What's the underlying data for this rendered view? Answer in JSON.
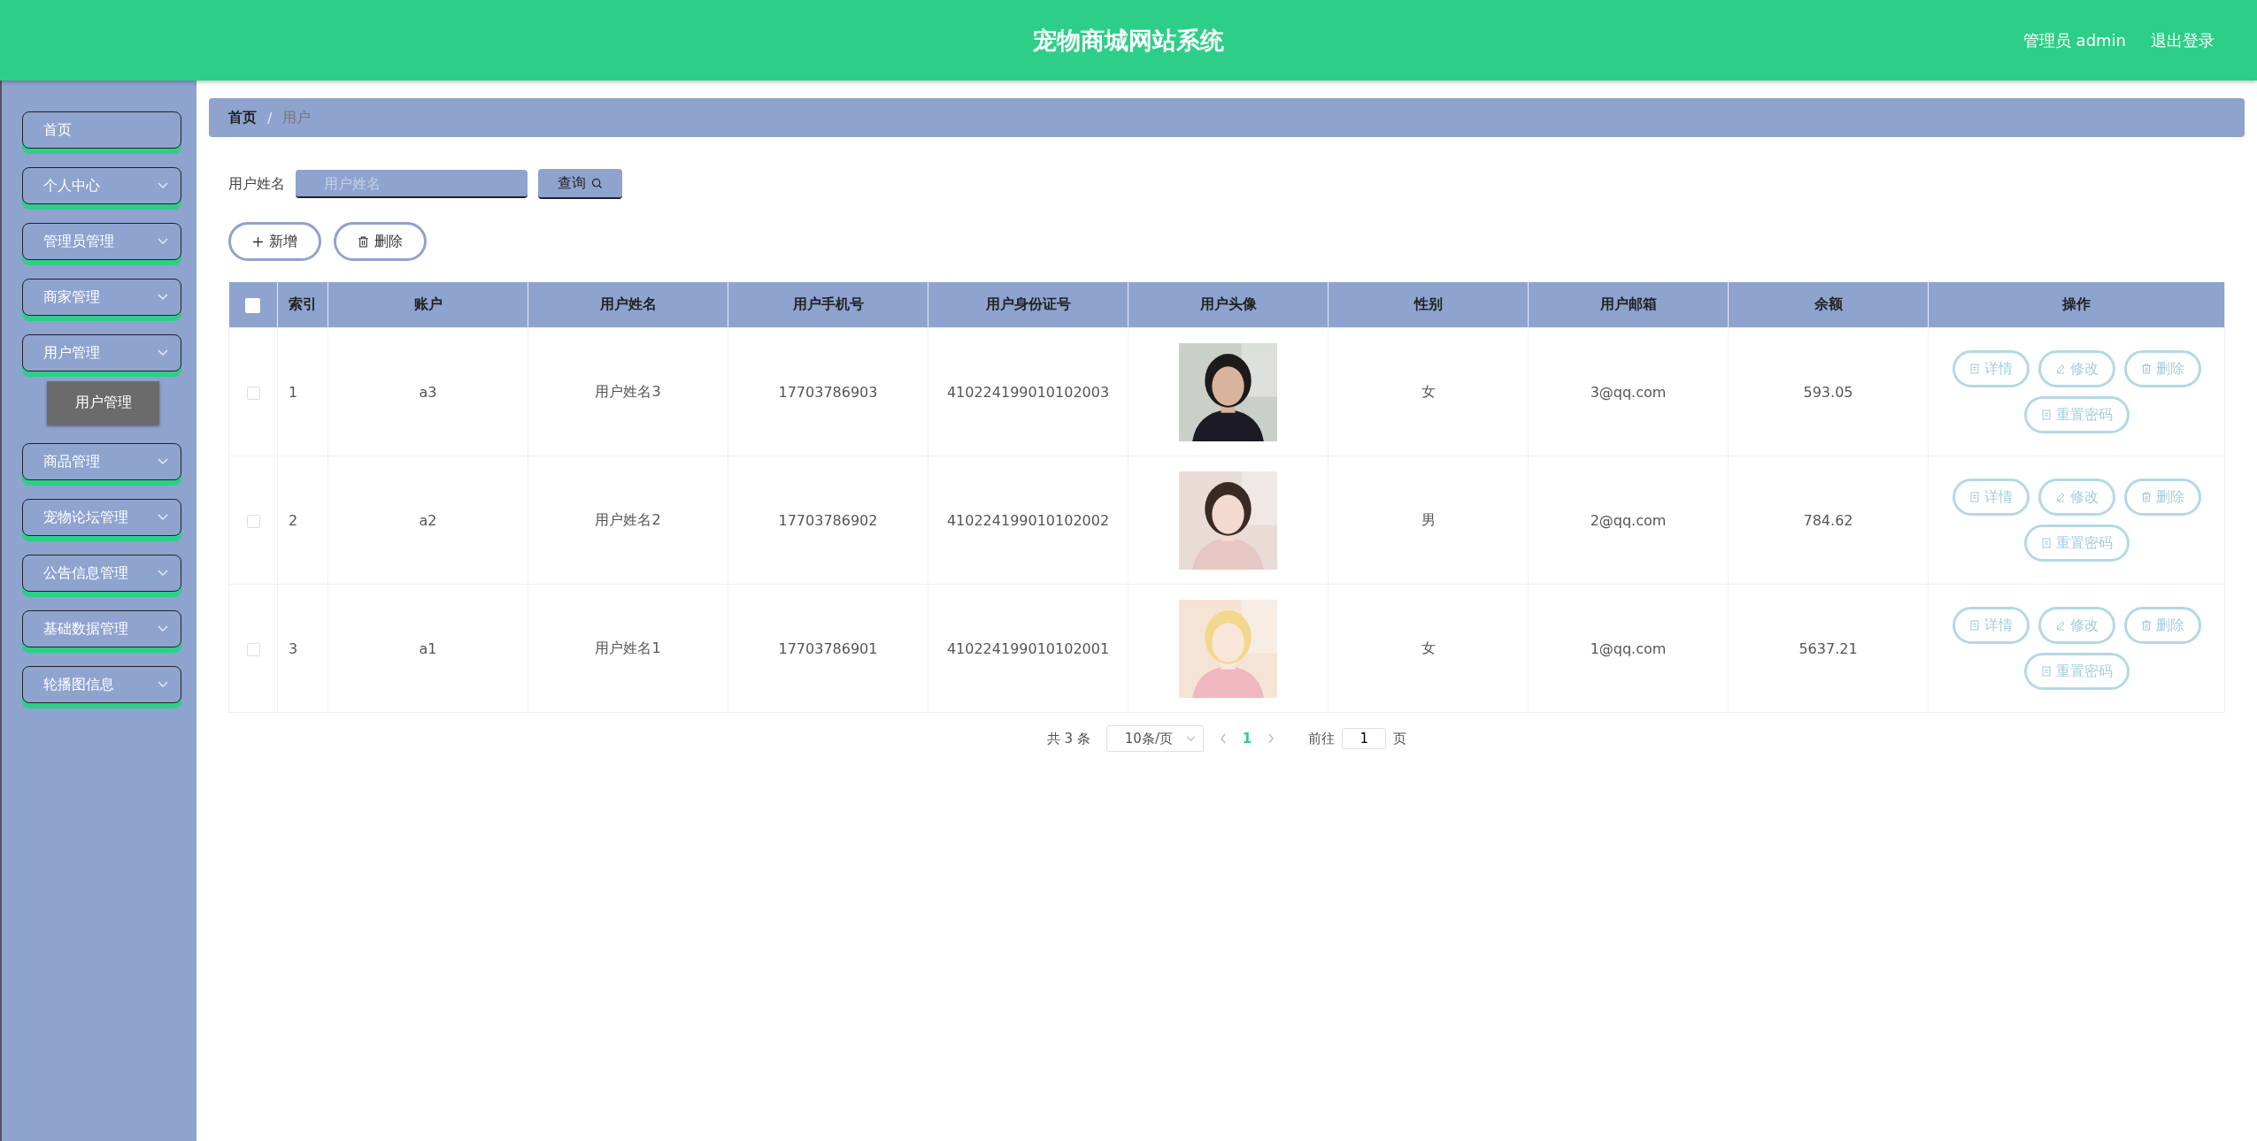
{
  "header": {
    "title": "宠物商城网站系统",
    "user": "管理员 admin",
    "logout": "退出登录"
  },
  "sidebar": {
    "items": [
      {
        "label": "首页",
        "kind": "link"
      },
      {
        "label": "个人中心",
        "kind": "menu"
      },
      {
        "label": "管理员管理",
        "kind": "menu"
      },
      {
        "label": "商家管理",
        "kind": "menu"
      },
      {
        "label": "用户管理",
        "kind": "menu",
        "children": [
          {
            "label": "用户管理",
            "selected": true
          }
        ]
      },
      {
        "label": "商品管理",
        "kind": "menu"
      },
      {
        "label": "宠物论坛管理",
        "kind": "menu"
      },
      {
        "label": "公告信息管理",
        "kind": "menu"
      },
      {
        "label": "基础数据管理",
        "kind": "menu"
      },
      {
        "label": "轮播图信息",
        "kind": "menu"
      }
    ]
  },
  "breadcrumb": {
    "separator": "/",
    "items": [
      "首页",
      "用户"
    ]
  },
  "search": {
    "label": "用户姓名",
    "placeholder": "用户姓名",
    "button": "查询"
  },
  "actions": [
    {
      "label": "新增",
      "kind": "add"
    },
    {
      "label": "删除",
      "kind": "delete"
    }
  ],
  "table": {
    "select_all": {
      "checked": false
    },
    "columns": [
      "索引",
      "账户",
      "用户姓名",
      "用户手机号",
      "用户身份证号",
      "用户头像",
      "性别",
      "用户邮箱",
      "余额",
      "操作"
    ],
    "rows": [
      {
        "checked": false,
        "index": "1",
        "account": "a3",
        "name": "用户姓名3",
        "phone": "17703786903",
        "id_number": "410224199010102003",
        "gender": "女",
        "email": "3@qq.com",
        "balance": "593.05",
        "actions": [
          {
            "label": "详情",
            "kind": "doc"
          },
          {
            "label": "修改",
            "kind": "edit"
          },
          {
            "label": "删除",
            "kind": "delete"
          },
          {
            "label": "重置密码",
            "kind": "doc"
          }
        ]
      },
      {
        "checked": false,
        "index": "2",
        "account": "a2",
        "name": "用户姓名2",
        "phone": "17703786902",
        "id_number": "410224199010102002",
        "gender": "男",
        "email": "2@qq.com",
        "balance": "784.62",
        "actions": [
          {
            "label": "详情",
            "kind": "doc"
          },
          {
            "label": "修改",
            "kind": "edit"
          },
          {
            "label": "删除",
            "kind": "delete"
          },
          {
            "label": "重置密码",
            "kind": "doc"
          }
        ]
      },
      {
        "checked": false,
        "index": "3",
        "account": "a1",
        "name": "用户姓名1",
        "phone": "17703786901",
        "id_number": "410224199010102001",
        "gender": "女",
        "email": "1@qq.com",
        "balance": "5637.21",
        "actions": [
          {
            "label": "详情",
            "kind": "doc"
          },
          {
            "label": "修改",
            "kind": "edit"
          },
          {
            "label": "删除",
            "kind": "delete"
          },
          {
            "label": "重置密码",
            "kind": "doc"
          }
        ]
      }
    ]
  },
  "pagination": {
    "total": "共 3 条",
    "page_size": "10条/页",
    "pages": [
      {
        "label": "1",
        "selected": true
      }
    ],
    "goto_label": "前往",
    "goto_value": "1",
    "goto_suffix": "页"
  }
}
